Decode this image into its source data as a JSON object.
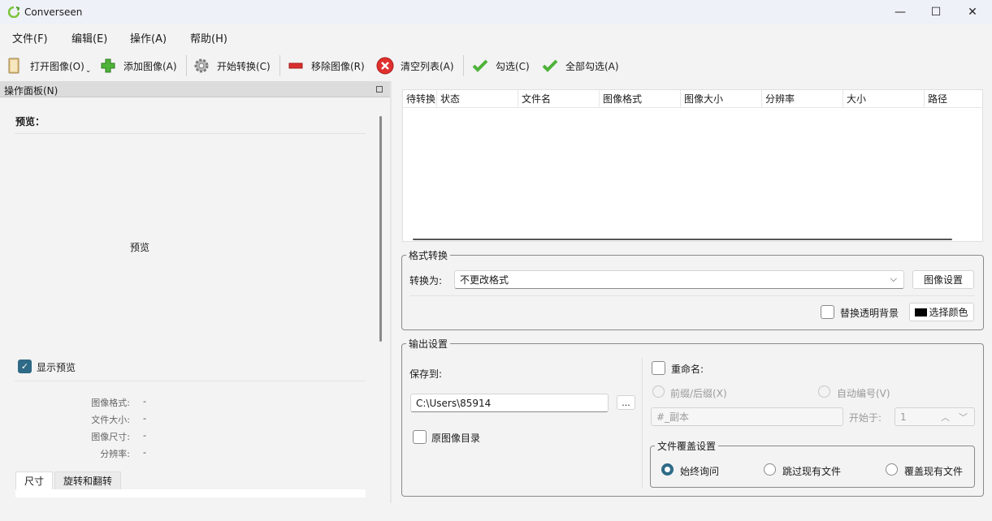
{
  "window": {
    "title": "Converseen",
    "minimize_glyph": "—",
    "maximize_glyph": "☐",
    "close_glyph": "✕"
  },
  "menu": [
    "文件(F)",
    "编辑(E)",
    "操作(A)",
    "帮助(H)"
  ],
  "toolbar": {
    "open": "打开图像(O)",
    "add": "添加图像(A)",
    "start": "开始转换(C)",
    "remove": "移除图像(R)",
    "clear": "清空列表(A)",
    "check": "勾选(C)",
    "check_all": "全部勾选(A)"
  },
  "panel": {
    "title": "操作面板(N)",
    "preview_heading": "预览：",
    "preview_placeholder": "预览",
    "show_preview": "显示预览",
    "show_preview_checked": true,
    "info": [
      {
        "label": "图像格式:",
        "value": "-"
      },
      {
        "label": "文件大小:",
        "value": "-"
      },
      {
        "label": "图像尺寸:",
        "value": "-"
      },
      {
        "label": "分辨率:",
        "value": "-"
      }
    ],
    "tabs": [
      "尺寸",
      "旋转和翻转"
    ]
  },
  "table": {
    "columns": [
      "待转换",
      "状态",
      "文件名",
      "图像格式",
      "图像大小",
      "分辨率",
      "大小",
      "路径"
    ],
    "rows": []
  },
  "format": {
    "group_title": "格式转换",
    "convert_label": "转换为:",
    "convert_value": "不更改格式",
    "image_settings": "图像设置",
    "replace_transparent": "替换透明背景",
    "choose_color": "选择颜色",
    "color_swatch": "#000000"
  },
  "output": {
    "group_title": "输出设置",
    "save_to_label": "保存到:",
    "save_path": "C:\\Users\\85914",
    "browse": "...",
    "original_dir": "原图像目录",
    "rename_label": "重命名:",
    "prefix_suffix": "前缀/后缀(X)",
    "auto_number": "自动编号(V)",
    "pattern": "#_副本",
    "start_at_label": "开始于:",
    "start_at_value": "1",
    "overwrite_title": "文件覆盖设置",
    "overwrite_options": [
      "始终询问",
      "跳过现有文件",
      "覆盖现有文件"
    ]
  },
  "colors": {
    "accent": "#2f6a87",
    "title_bg": "#eef1f8",
    "window_bg": "#f3f3f3"
  }
}
